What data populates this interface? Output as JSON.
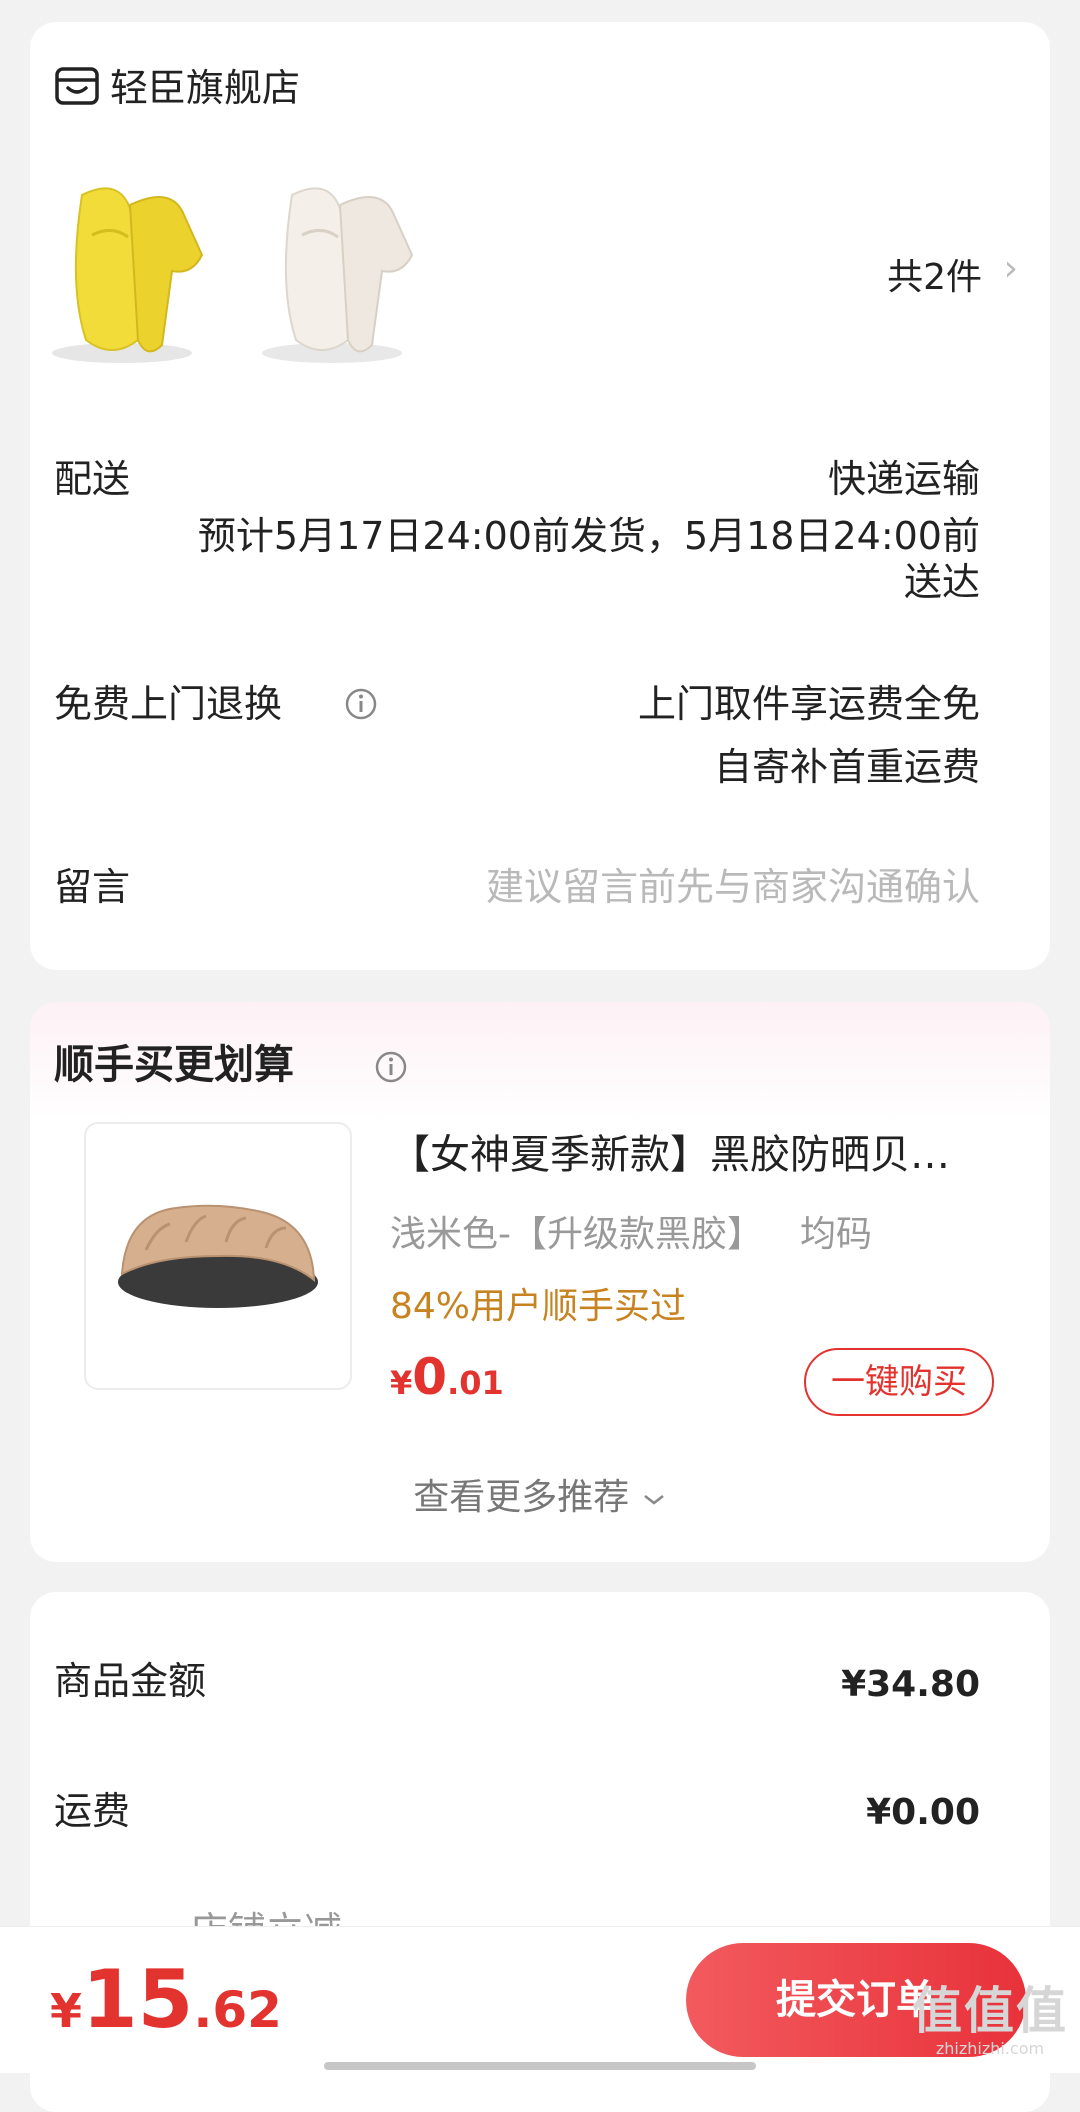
{
  "store": {
    "name": "轻臣旗舰店",
    "item_count": "共2件",
    "delivery_label": "配送",
    "delivery_method": "快递运输",
    "delivery_estimate_line1": "预计5月17日24:00前发货，5月18日24:00前",
    "delivery_estimate_line2": "送达",
    "return_label": "免费上门退换",
    "return_line1": "上门取件享运费全免",
    "return_line2": "自寄补首重运费",
    "message_label": "留言",
    "message_placeholder": "建议留言前先与商家沟通确认"
  },
  "recommend": {
    "title": "顺手买更划算",
    "product_title": "【女神夏季新款】黑胶防晒贝…",
    "product_spec": "浅米色-【升级款黑胶】",
    "product_size": "均码",
    "bought_rate": "84%用户顺手买过",
    "price_symbol": "¥",
    "price_int": "0",
    "price_dec": ".01",
    "buy_button": "一键购买",
    "more": "查看更多推荐"
  },
  "summary": {
    "goods_label": "商品金额",
    "goods_value": "¥34.80",
    "shipping_label": "运费",
    "shipping_value": "¥0.00",
    "partial_row": "店铺立减"
  },
  "bottom": {
    "total_symbol": "¥",
    "total_int": "15",
    "total_dec": ".62",
    "submit": "提交订单"
  },
  "watermark": {
    "text": "值值值",
    "site": "zhizhizhi.com"
  },
  "colors": {
    "accent": "#e2332f",
    "orange": "#c88321",
    "background": "#f2f2f2"
  },
  "icons": [
    "store-icon",
    "info-icon",
    "chevron-right-icon",
    "chevron-down-icon"
  ]
}
